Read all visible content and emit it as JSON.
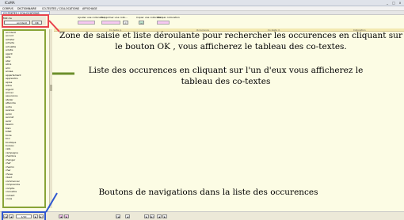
{
  "window": {
    "title": "ICoMA",
    "controls": [
      "_",
      "□",
      "x"
    ]
  },
  "menubar": {
    "items": [
      "CORPUS",
      "DICTIONNAIRE",
      "CO-TEXTES / COLLOCATIONS",
      "AFFICHAGE"
    ]
  },
  "tabs": [
    {
      "label": "CO-TEXTES / COLLOCATIONS"
    }
  ],
  "search": {
    "label": "Mot cle",
    "value": "accident",
    "ok_label": "OK"
  },
  "tools": {
    "add_label": "Ajouter une collocation",
    "remove_label": "Supprimer une collo...",
    "copy_label": "Copier une collocation",
    "view_label": "Voir par collocation",
    "btn_minus": "<",
    "btn_plus": ">",
    "btn_copy": "↔"
  },
  "columns": [
    "Co-texte g.",
    "Occurrence",
    "Co-texte d.",
    "Collocation"
  ],
  "occurrences": [
    "accident",
    "accord",
    "acheter",
    "activite",
    "actualite",
    "adulte",
    "agent",
    "aide",
    "aller",
    "alors",
    "ami",
    "annee",
    "appartement",
    "apprendre",
    "apres",
    "arbre",
    "argent",
    "arriver",
    "assurance",
    "atelier",
    "attendre",
    "autre",
    "avenue",
    "avion",
    "avocat",
    "avoir",
    "besoin",
    "bien",
    "billet",
    "boire",
    "bon",
    "boutique",
    "bureau",
    "cafe",
    "campagne",
    "chambre",
    "changer",
    "chef",
    "chemin",
    "cher",
    "chose",
    "client",
    "commencer",
    "comprendre",
    "compte",
    "connaitre",
    "content",
    "corps"
  ],
  "navigation": {
    "first": "|◄",
    "prev": "◄",
    "info": "1/10",
    "next": "►",
    "last": "►|",
    "extra_left": [
      "◄",
      "►"
    ],
    "extra_mid": [
      "|◄",
      "◄",
      "►",
      "►|"
    ],
    "extra_right": [
      "◄",
      "►"
    ]
  },
  "annotations": {
    "search_help": "Zone de saisie et liste déroulante pour rechercher les occurences en cliquant sur le bouton OK , vous afficherez le tableau des co-textes.",
    "list_help": "Liste des occurences en cliquant sur l'un d'eux vous afficherez le tableau des co-textes",
    "nav_help": "Boutons de navigations dans la liste des occurences"
  },
  "colors": {
    "red_highlight": "#e8434c",
    "green_highlight": "#88a437",
    "blue_highlight": "#2f57d0",
    "content_background": "#fcfce4",
    "header_background": "#f3e9b1"
  }
}
